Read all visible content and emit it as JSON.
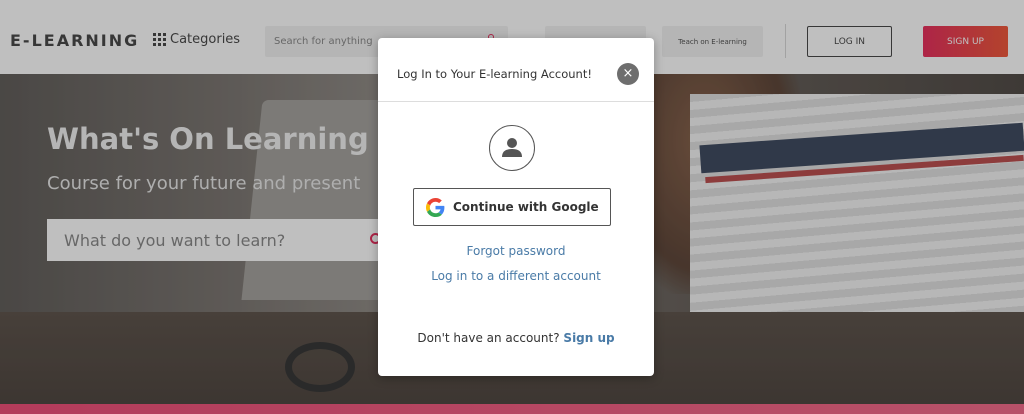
{
  "header": {
    "logo": "E-LEARNING",
    "categories_label": "Categories",
    "search_placeholder": "Search for anything",
    "teach_label": "Teach on E-learning",
    "login_label": "LOG IN",
    "signup_label": "SIGN UP"
  },
  "hero": {
    "title": "What's On Learning ?",
    "subtitle": "Course for your future and present",
    "search_placeholder": "What do you want to learn?"
  },
  "modal": {
    "title": "Log In to Your E-learning Account!",
    "close_icon": "×",
    "google_label": "Continue with Google",
    "forgot_password": "Forgot password",
    "different_account": "Log in to a different account",
    "no_account_text": "Don't have an account?",
    "signup_link": "Sign up"
  },
  "colors": {
    "accent": "#e8315f",
    "link": "#4a7ba7"
  },
  "icons": {
    "categories": "grid-icon",
    "avatar": "user-icon",
    "google": "google-g-icon",
    "close": "close-icon",
    "search": "search-icon"
  }
}
